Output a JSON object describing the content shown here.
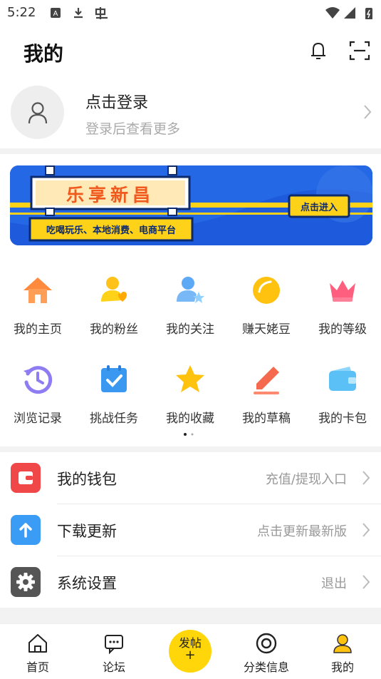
{
  "status_bar": {
    "time": "5:22"
  },
  "header": {
    "title": "我的",
    "bell_icon": "bell-icon",
    "scan_icon": "scan-icon"
  },
  "profile": {
    "title": "点击登录",
    "subtitle": "登录后查看更多"
  },
  "banner": {
    "title": "乐享新昌",
    "subtitle": "吃喝玩乐、本地消费、电商平台",
    "cta": "点击进入"
  },
  "grid": {
    "row1": [
      {
        "label": "我的主页",
        "icon": "home-icon"
      },
      {
        "label": "我的粉丝",
        "icon": "fans-icon"
      },
      {
        "label": "我的关注",
        "icon": "follow-icon"
      },
      {
        "label": "赚天姥豆",
        "icon": "bean-icon"
      },
      {
        "label": "我的等级",
        "icon": "crown-icon"
      }
    ],
    "row2": [
      {
        "label": "浏览记录",
        "icon": "history-icon"
      },
      {
        "label": "挑战任务",
        "icon": "task-icon"
      },
      {
        "label": "我的收藏",
        "icon": "star-icon"
      },
      {
        "label": "我的草稿",
        "icon": "pencil-icon"
      },
      {
        "label": "我的卡包",
        "icon": "card-wallet-icon"
      }
    ]
  },
  "list": [
    {
      "label": "我的钱包",
      "value": "充值/提现入口",
      "icon": "wallet-icon",
      "color": "#f04848"
    },
    {
      "label": "下载更新",
      "value": "点击更新最新版",
      "icon": "upload-arrow-icon",
      "color": "#3b9cf5"
    },
    {
      "label": "系统设置",
      "value": "退出",
      "icon": "gear-icon",
      "color": "#555555"
    }
  ],
  "bottom_nav": {
    "home": "首页",
    "forum": "论坛",
    "post": "发帖",
    "post_plus": "+",
    "category": "分类信息",
    "mine": "我的"
  },
  "colors": {
    "accent": "#ffd60a",
    "banner_blue": "#1e5cdc"
  }
}
